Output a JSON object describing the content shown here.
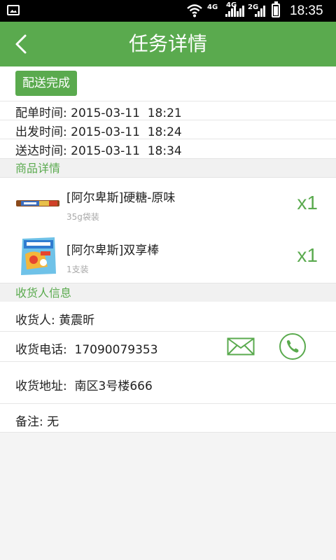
{
  "status_bar": {
    "net1": "4G",
    "net2": "4G",
    "net3": "2G",
    "time": "18:35"
  },
  "header": {
    "title": "任务详情"
  },
  "order": {
    "status": "配送完成",
    "times": [
      {
        "label": "配单时间",
        "value": "2015-03-11  18:21"
      },
      {
        "label": "出发时间",
        "value": "2015-03-11  18:24"
      },
      {
        "label": "送达时间",
        "value": "2015-03-11  18:34"
      }
    ]
  },
  "products_section": {
    "title": "商品详情",
    "items": [
      {
        "name": "[阿尔卑斯]硬糖-原味",
        "spec": "35g袋装",
        "qty": "x1"
      },
      {
        "name": "[阿尔卑斯]双享棒",
        "spec": "1支装",
        "qty": "x1"
      }
    ]
  },
  "receiver_section": {
    "title": "收货人信息",
    "name_label": "收货人",
    "name": "黄震昕",
    "phone_label": "收货电话",
    "phone": "17090079353",
    "address_label": "收货地址",
    "address": "南区3号楼666",
    "note_label": "备注",
    "note": "无"
  },
  "colors": {
    "accent": "#5aaa4e",
    "status_bar": "#000000"
  },
  "icons": [
    "photo-icon",
    "wifi-icon",
    "signal-icon",
    "battery-icon",
    "back-arrow-icon",
    "mail-icon",
    "phone-icon"
  ]
}
